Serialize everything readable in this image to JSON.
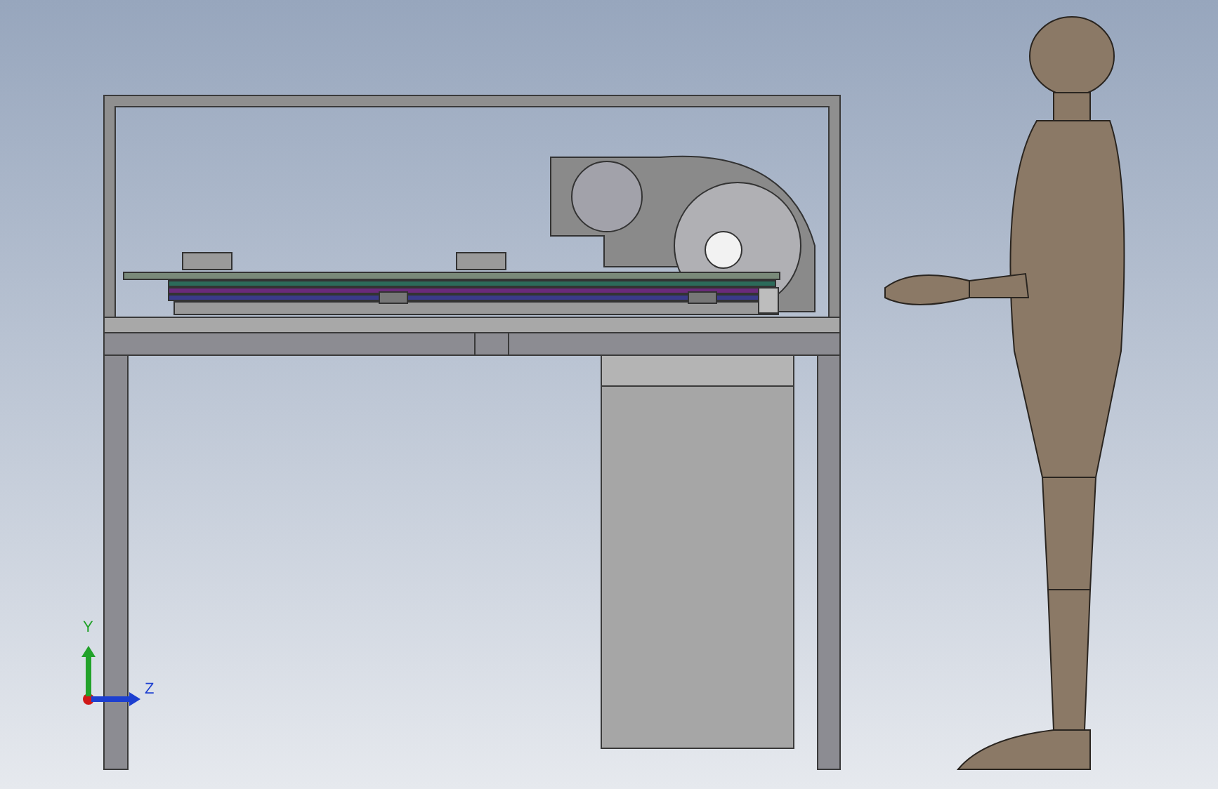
{
  "viewport": {
    "triad": {
      "axes": [
        {
          "label": "Y",
          "color": "#22a22a"
        },
        {
          "label": "Z",
          "color": "#1d3fd0"
        }
      ]
    }
  }
}
